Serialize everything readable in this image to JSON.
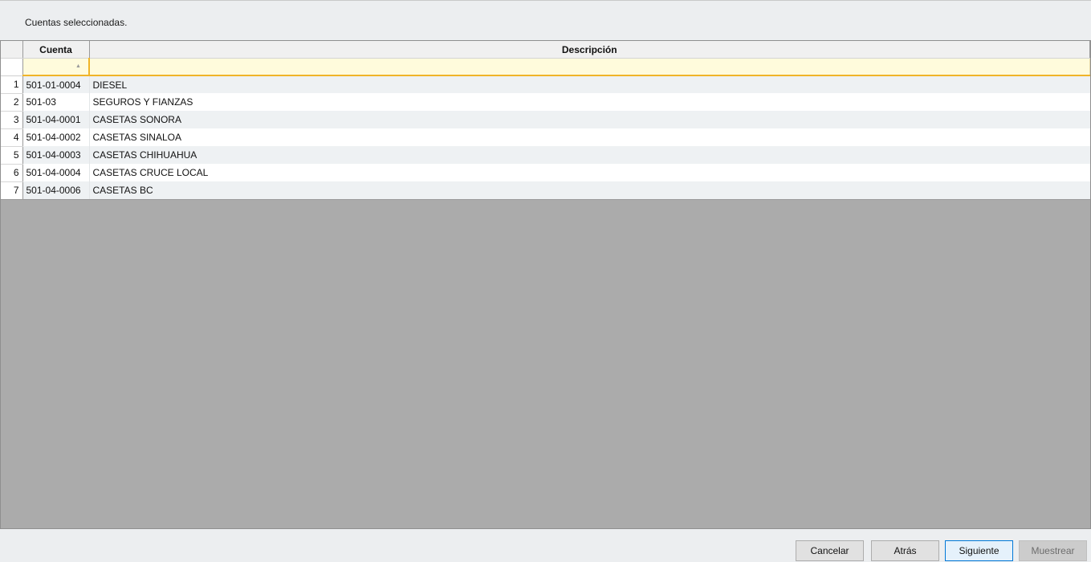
{
  "instruction": "Cuentas seleccionadas.",
  "grid": {
    "columns": {
      "cuenta": "Cuenta",
      "descripcion": "Descripción"
    },
    "rows": [
      {
        "num": "1",
        "cuenta": "501-01-0004",
        "descripcion": "DIESEL"
      },
      {
        "num": "2",
        "cuenta": "501-03",
        "descripcion": "SEGUROS Y FIANZAS"
      },
      {
        "num": "3",
        "cuenta": "501-04-0001",
        "descripcion": "CASETAS SONORA"
      },
      {
        "num": "4",
        "cuenta": "501-04-0002",
        "descripcion": "CASETAS SINALOA"
      },
      {
        "num": "5",
        "cuenta": "501-04-0003",
        "descripcion": "CASETAS CHIHUAHUA"
      },
      {
        "num": "6",
        "cuenta": "501-04-0004",
        "descripcion": "CASETAS CRUCE LOCAL"
      },
      {
        "num": "7",
        "cuenta": "501-04-0006",
        "descripcion": "CASETAS BC"
      }
    ],
    "filter_cuenta": "",
    "filter_descripcion": "",
    "sort_indicator": "sort-ascending-icon"
  },
  "buttons": {
    "cancel": "Cancelar",
    "back": "Atrás",
    "next": "Siguiente",
    "sample": "Muestrear"
  },
  "colors": {
    "filter_row": "#fffbdc",
    "filter_border": "#f0b428",
    "primary_border": "#0078d7",
    "empty_area": "#ababab"
  }
}
